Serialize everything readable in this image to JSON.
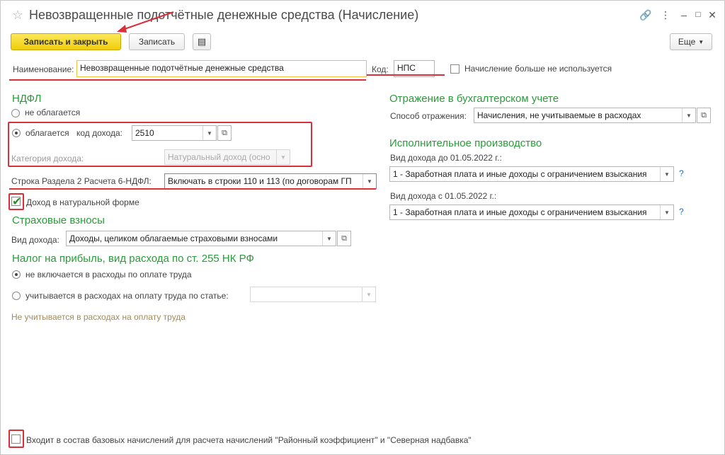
{
  "window": {
    "title": "Невозвращенные подотчётные денежные средства (Начисление)",
    "controls": [
      "link-icon",
      "more-icon",
      "minimize-icon",
      "maximize-icon",
      "close-icon"
    ]
  },
  "toolbar": {
    "save_close": "Записать и закрыть",
    "save": "Записать",
    "more": "Еще"
  },
  "name_row": {
    "name_label": "Наименование:",
    "name_value": "Невозвращенные подотчётные денежные средства",
    "code_label": "Код:",
    "code_value": "НПС",
    "not_used_label": "Начисление больше не используется"
  },
  "ndfl": {
    "header": "НДФЛ",
    "option_not_taxed": "не облагается",
    "option_taxed": "облагается",
    "income_code_label": "код дохода:",
    "income_code_value": "2510",
    "category_label": "Категория дохода:",
    "category_value": "Натуральный доход (осно",
    "row_6ndfl_label": "Строка Раздела 2 Расчета 6-НДФЛ:",
    "row_6ndfl_value": "Включать в строки 110 и 113 (по договорам ГП",
    "natural_form_label": "Доход в натуральной форме"
  },
  "insurance": {
    "header": "Страховые взносы",
    "income_type_label": "Вид дохода:",
    "income_type_value": "Доходы, целиком облагаемые страховыми взносами"
  },
  "profit_tax": {
    "header": "Налог на прибыль, вид расхода по ст. 255 НК РФ",
    "option_not_included": "не включается в расходы по оплате труда",
    "option_included": "учитывается в расходах на оплату труда по статье:",
    "note": "Не учитывается в расходах на оплату труда"
  },
  "accounting": {
    "header": "Отражение в бухгалтерском учете",
    "method_label": "Способ отражения:",
    "method_value": "Начисления, не учитываемые в расходах"
  },
  "enforcement": {
    "header": "Исполнительное производство",
    "before_label": "Вид дохода до 01.05.2022 г.:",
    "before_value": "1 - Заработная плата и иные доходы с ограничением взыскания",
    "after_label": "Вид дохода с 01.05.2022 г.:",
    "after_value": "1 - Заработная плата и иные доходы с ограничением взыскания",
    "help": "?"
  },
  "footer": {
    "base_accruals_label": "Входит в состав базовых начислений для расчета начислений \"Районный коэффициент\" и \"Северная надбавка\""
  },
  "colors": {
    "accent_green": "#2b9a3a",
    "primary_button": "#f5d51a",
    "annotation_red": "#d9303a"
  }
}
